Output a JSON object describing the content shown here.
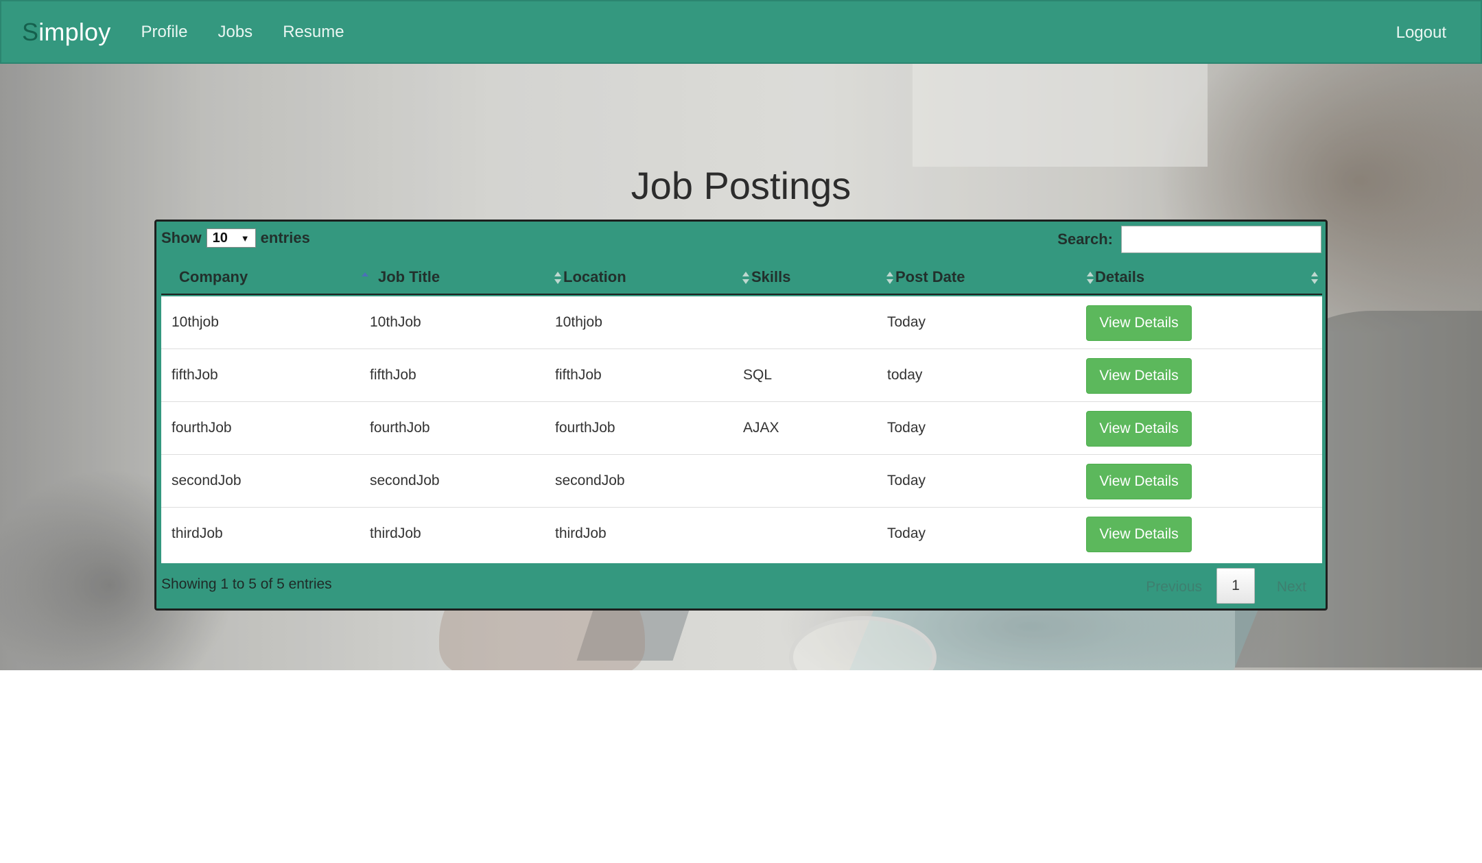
{
  "nav": {
    "brand_first": "S",
    "brand_rest": "imploy",
    "links": [
      "Profile",
      "Jobs",
      "Resume"
    ],
    "logout": "Logout"
  },
  "page": {
    "title": "Job Postings"
  },
  "table_controls": {
    "show_label": "Show",
    "entries_value": "10",
    "entries_label": "entries",
    "search_label": "Search:",
    "search_value": ""
  },
  "columns": [
    "Company",
    "Job Title",
    "Location",
    "Skills",
    "Post Date",
    "Details"
  ],
  "sorted_column": "Company",
  "rows": [
    {
      "company": "10thjob",
      "title": "10thJob",
      "location": "10thjob",
      "skills": "",
      "post_date": "Today",
      "action": "View Details"
    },
    {
      "company": "fifthJob",
      "title": "fifthJob",
      "location": "fifthJob",
      "skills": "SQL",
      "post_date": "today",
      "action": "View Details"
    },
    {
      "company": "fourthJob",
      "title": "fourthJob",
      "location": "fourthJob",
      "skills": "AJAX",
      "post_date": "Today",
      "action": "View Details"
    },
    {
      "company": "secondJob",
      "title": "secondJob",
      "location": "secondJob",
      "skills": "",
      "post_date": "Today",
      "action": "View Details"
    },
    {
      "company": "thirdJob",
      "title": "thirdJob",
      "location": "thirdJob",
      "skills": "",
      "post_date": "Today",
      "action": "View Details"
    }
  ],
  "footer": {
    "info": "Showing 1 to 5 of 5 entries",
    "previous": "Previous",
    "current_page": "1",
    "next": "Next"
  },
  "colors": {
    "navbar": "#34987f",
    "card": "#34987f",
    "button": "#5cb85c",
    "brand_first_letter": "#15604d"
  }
}
